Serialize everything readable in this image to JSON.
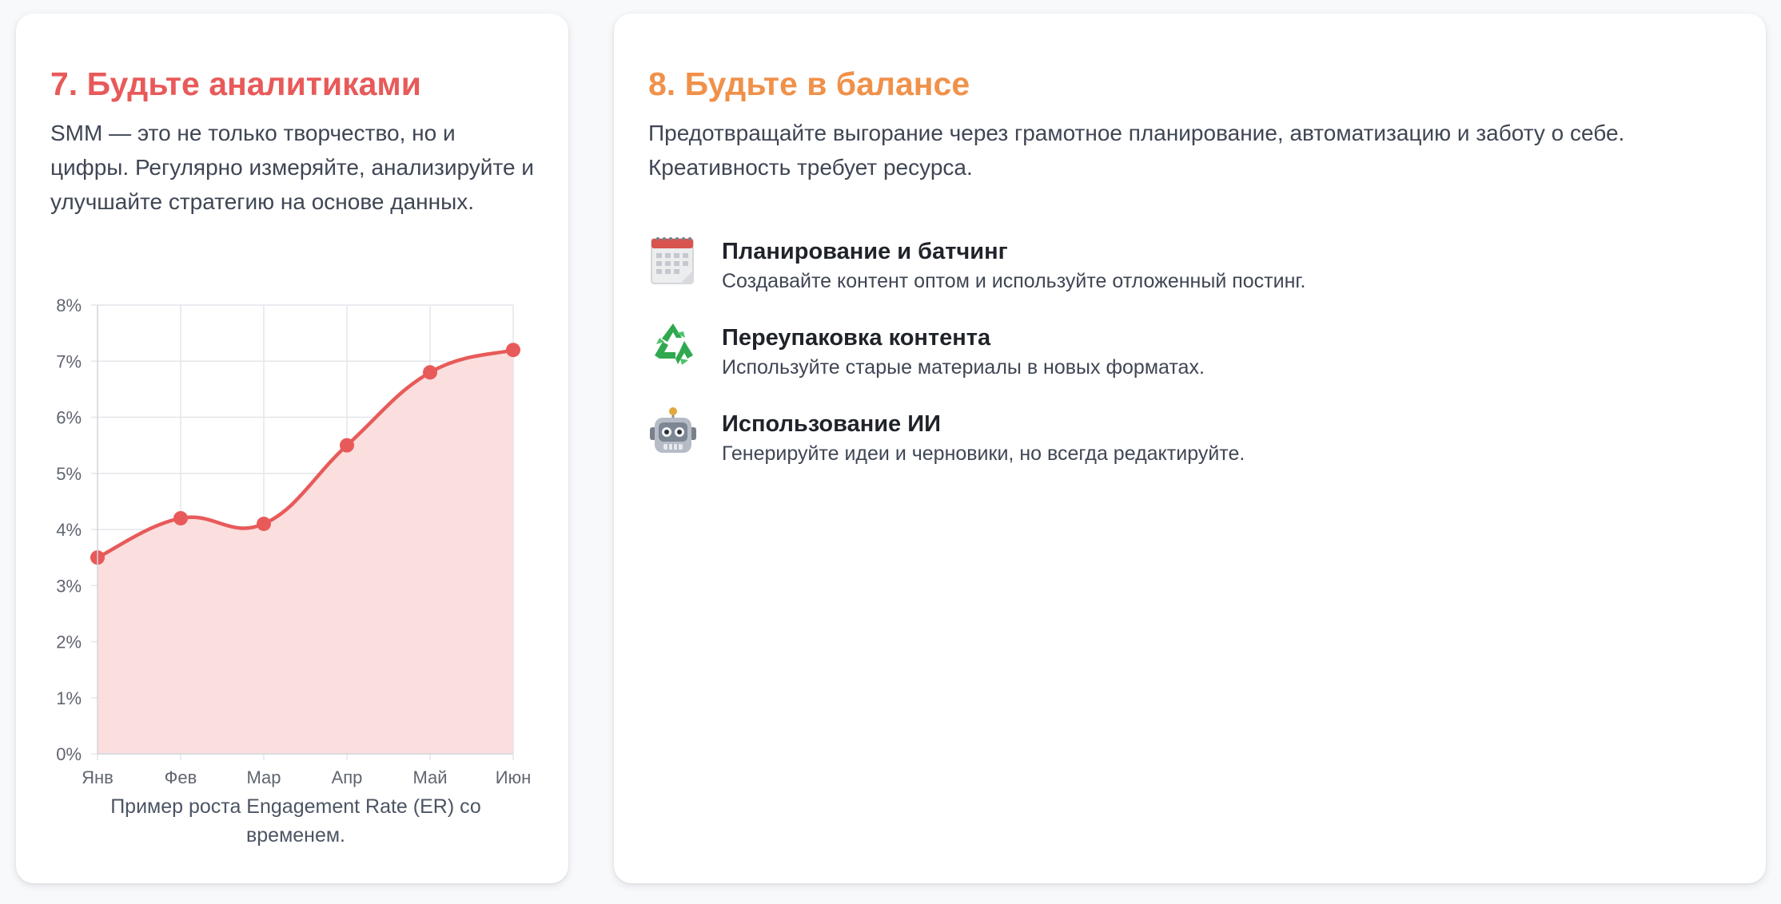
{
  "analytics": {
    "title": "7. Будьте аналитиками",
    "lead": "SMM — это не только творчество, но и цифры. Регулярно измеряйте, анализируйте и улучшайте стратегию на основе данных.",
    "caption": "Пример роста Engagement Rate (ER) со временем."
  },
  "balance": {
    "title": "8. Будьте в балансе",
    "lead": "Предотвращайте выгорание через грамотное планирование, автоматизацию и заботу о себе. Креативность требует ресурса.",
    "features": [
      {
        "icon": "calendar-icon",
        "title": "Планирование и батчинг",
        "desc": "Создавайте контент оптом и используйте отложенный постинг."
      },
      {
        "icon": "recycle-icon",
        "title": "Переупаковка контента",
        "desc": "Используйте старые материалы в новых форматах."
      },
      {
        "icon": "robot-icon",
        "title": "Использование ИИ",
        "desc": "Генерируйте идеи и черновики, но всегда редактируйте."
      }
    ]
  },
  "colors": {
    "analytics_accent": "#e85a5a",
    "balance_accent": "#f0914a",
    "line": "#e85a5a",
    "fill": "#fbdcdc"
  },
  "chart_data": {
    "type": "line",
    "categories": [
      "Янв",
      "Фев",
      "Мар",
      "Апр",
      "Май",
      "Июн"
    ],
    "values": [
      3.5,
      4.2,
      4.1,
      5.5,
      6.8,
      7.2
    ],
    "yticks": [
      "0%",
      "1%",
      "2%",
      "3%",
      "4%",
      "5%",
      "6%",
      "7%",
      "8%"
    ],
    "ylim": [
      0,
      8
    ],
    "grid": true,
    "filled": true,
    "title": "",
    "xlabel": "",
    "ylabel": ""
  }
}
